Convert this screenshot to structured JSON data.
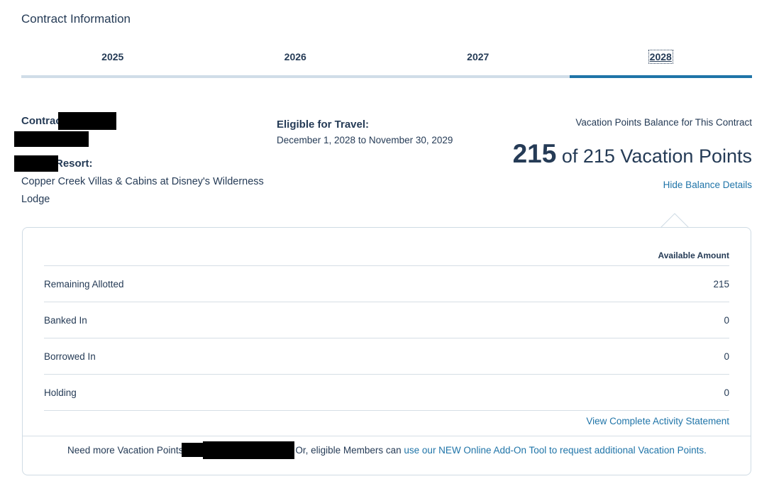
{
  "page": {
    "title": "Contract Information"
  },
  "tabs": [
    {
      "label": "2025"
    },
    {
      "label": "2026"
    },
    {
      "label": "2027"
    },
    {
      "label": "2028"
    }
  ],
  "colors": {
    "accent": "#1f74a8",
    "text": "#253b56",
    "tab_inactive": "#d0dde8"
  },
  "contract": {
    "label_partial": "Contrac",
    "resort_label_partial": "Resort:",
    "resort_name": "Copper Creek Villas & Cabins at Disney's Wilderness Lodge"
  },
  "travel": {
    "label": "Eligible for Travel:",
    "dates": "December 1, 2028 to November 30, 2029"
  },
  "balance": {
    "title": "Vacation Points Balance for This Contract",
    "available": "215",
    "rest": " of 215 Vacation Points",
    "hide_link": "Hide Balance Details"
  },
  "details": {
    "column_header": "Available Amount",
    "rows": [
      {
        "label": "Remaining Allotted",
        "value": "215"
      },
      {
        "label": "Banked In",
        "value": "0"
      },
      {
        "label": "Borrowed In",
        "value": "0"
      },
      {
        "label": "Holding",
        "value": "0"
      }
    ],
    "activity_link": "View Complete Activity Statement"
  },
  "footer": {
    "prefix": "Need more Vacation Points",
    "middle": "Or, eligible Members can ",
    "link": "use our NEW Online Add-On Tool to request additional Vacation Points."
  }
}
